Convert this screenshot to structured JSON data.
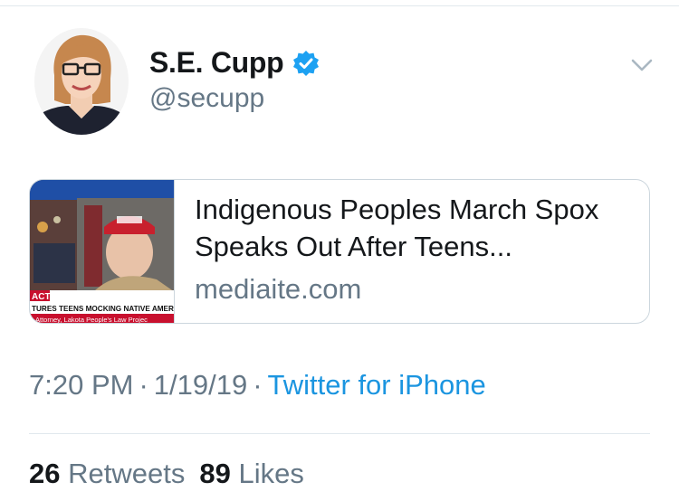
{
  "tweet": {
    "author": {
      "display_name": "S.E. Cupp",
      "handle": "@secupp",
      "verified": true
    },
    "card": {
      "title": "Indigenous Peoples March Spox Speaks Out After Teens...",
      "domain": "mediaite.com",
      "thumbnail_text": {
        "tag": "ACT",
        "headline": "TURES TEENS MOCKING NATIVE AMERICAN VE",
        "caption": "Attorney, Lakota People's Law Projec"
      }
    },
    "meta": {
      "time": "7:20 PM",
      "separator": "·",
      "date": "1/19/19",
      "source": "Twitter for iPhone"
    },
    "stats": {
      "retweets_count": "26",
      "retweets_label": "Retweets",
      "likes_count": "89",
      "likes_label": "Likes"
    }
  },
  "icons": {
    "verified": "verified-badge-icon",
    "menu": "chevron-down-icon"
  },
  "colors": {
    "text_primary": "#14171a",
    "text_secondary": "#657786",
    "link": "#1b95e0",
    "verified": "#1da1f2",
    "border": "#ccd6dd"
  }
}
